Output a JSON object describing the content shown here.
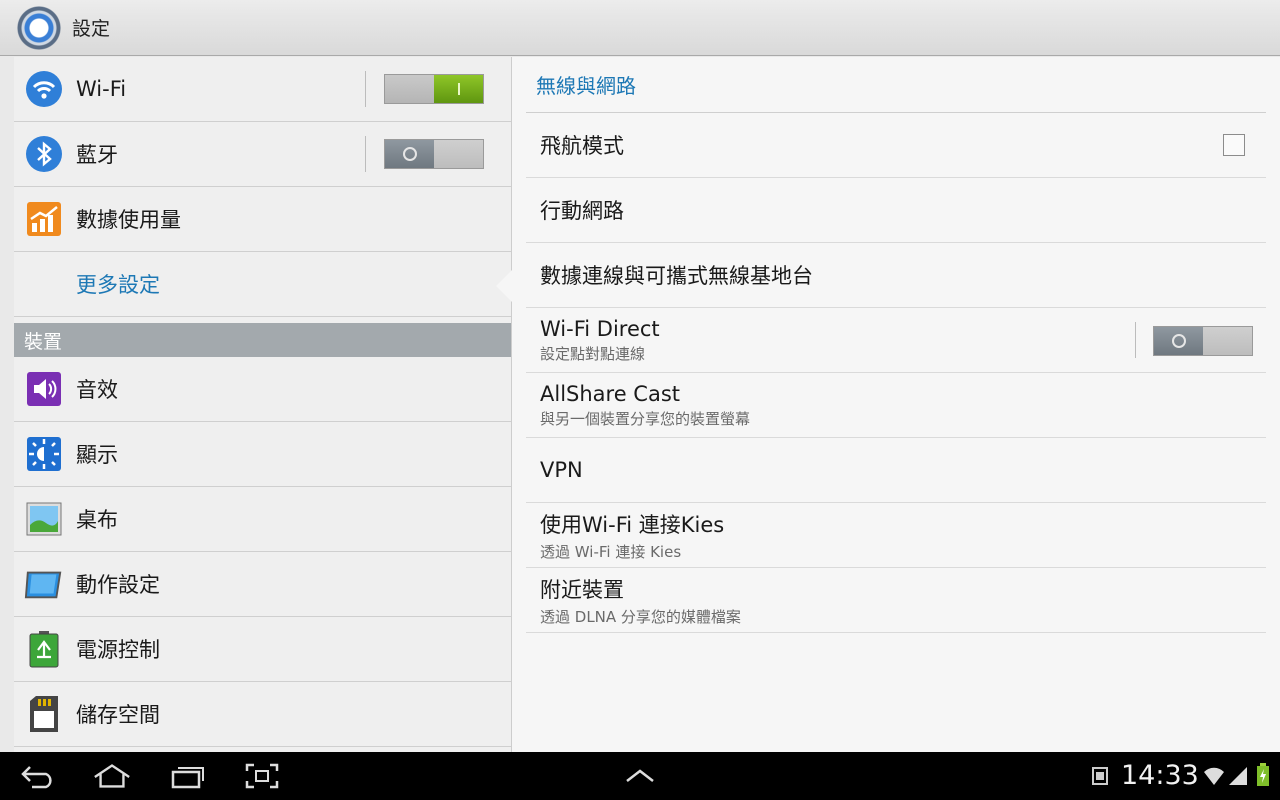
{
  "app": {
    "title": "設定"
  },
  "left": {
    "items_top": [
      {
        "label": "Wi-Fi",
        "icon": "wifi-icon",
        "toggle": "on"
      },
      {
        "label": "藍牙",
        "icon": "bluetooth-icon",
        "toggle": "off"
      },
      {
        "label": "數據使用量",
        "icon": "data-usage-icon"
      },
      {
        "label": "更多設定",
        "selected": true
      }
    ],
    "section_device": "裝置",
    "items_device": [
      {
        "label": "音效",
        "icon": "sound-icon"
      },
      {
        "label": "顯示",
        "icon": "display-icon"
      },
      {
        "label": "桌布",
        "icon": "wallpaper-icon"
      },
      {
        "label": "動作設定",
        "icon": "motion-icon"
      },
      {
        "label": "電源控制",
        "icon": "power-saving-icon"
      },
      {
        "label": "儲存空間",
        "icon": "storage-icon"
      }
    ]
  },
  "right": {
    "header": "無線與網路",
    "items": [
      {
        "title": "飛航模式",
        "control": "checkbox",
        "checked": false
      },
      {
        "title": "行動網路"
      },
      {
        "title": "數據連線與可攜式無線基地台"
      },
      {
        "title": "Wi-Fi Direct",
        "subtitle": "設定點對點連線",
        "control": "toggle",
        "toggle": "off"
      },
      {
        "title": "AllShare Cast",
        "subtitle": "與另一個裝置分享您的裝置螢幕"
      },
      {
        "title": "VPN"
      },
      {
        "title": "使用Wi-Fi 連接Kies",
        "subtitle": "透過 Wi-Fi 連接 Kies"
      },
      {
        "title": "附近裝置",
        "subtitle": "透過 DLNA 分享您的媒體檔案"
      }
    ]
  },
  "status": {
    "time": "14:33",
    "icons": [
      "screenshot-icon",
      "wifi-signal-icon",
      "cell-signal-icon",
      "battery-charging-icon"
    ]
  },
  "nav": {
    "buttons": [
      "back-icon",
      "home-icon",
      "recent-apps-icon",
      "screen-capture-icon",
      "expand-up-icon"
    ]
  },
  "colors": {
    "accent": "#1d78b5",
    "toggle_on": "#6aa517",
    "section_header": "#a3a9ad"
  }
}
